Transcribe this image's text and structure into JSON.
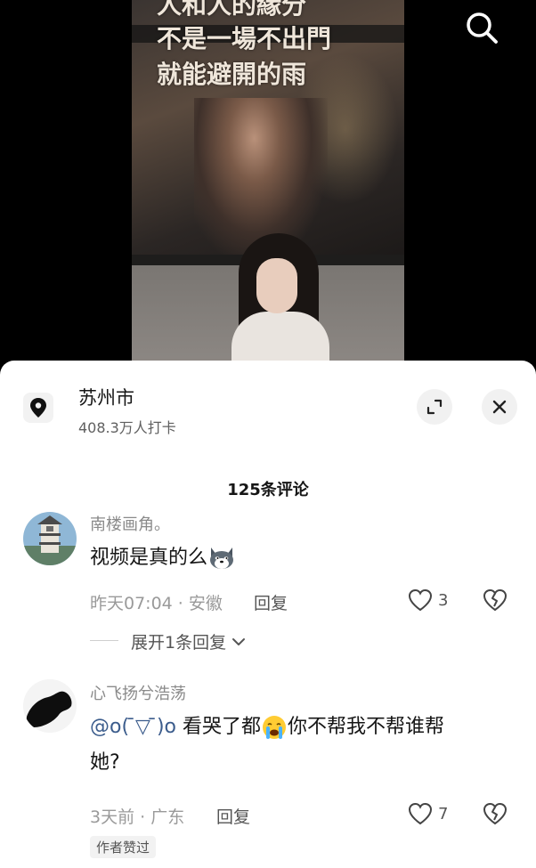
{
  "video": {
    "subtitle_lines": [
      "人和人的緣分",
      "不是一場不出門",
      "就能避開的雨"
    ]
  },
  "location": {
    "name": "苏州市",
    "checkins": "408.3万人打卡"
  },
  "comments_header": "125条评论",
  "comments": [
    {
      "author": "南楼画角。",
      "text": "视频是真的么",
      "time_place": "昨天07:04 · 安徽",
      "reply_label": "回复",
      "likes": "3",
      "expand_label": "展开1条回复"
    },
    {
      "author": "心飞扬兮浩荡",
      "mention": "@o( ̄▽ ̄)o",
      "text_part1": "看哭了都",
      "text_part2": "你不帮我不帮谁帮",
      "text_part3": "她?",
      "time_place": "3天前 · 广东",
      "reply_label": "回复",
      "likes": "7",
      "badge": "作者赞过"
    }
  ],
  "colors": {
    "mention": "#3b5c8c",
    "meta": "#9a9a9a",
    "sheet": "#ffffff"
  },
  "icons": [
    "search-icon",
    "location-pin-icon",
    "expand-icon",
    "close-icon",
    "heart-icon",
    "broken-heart-icon",
    "chevron-down-icon"
  ]
}
